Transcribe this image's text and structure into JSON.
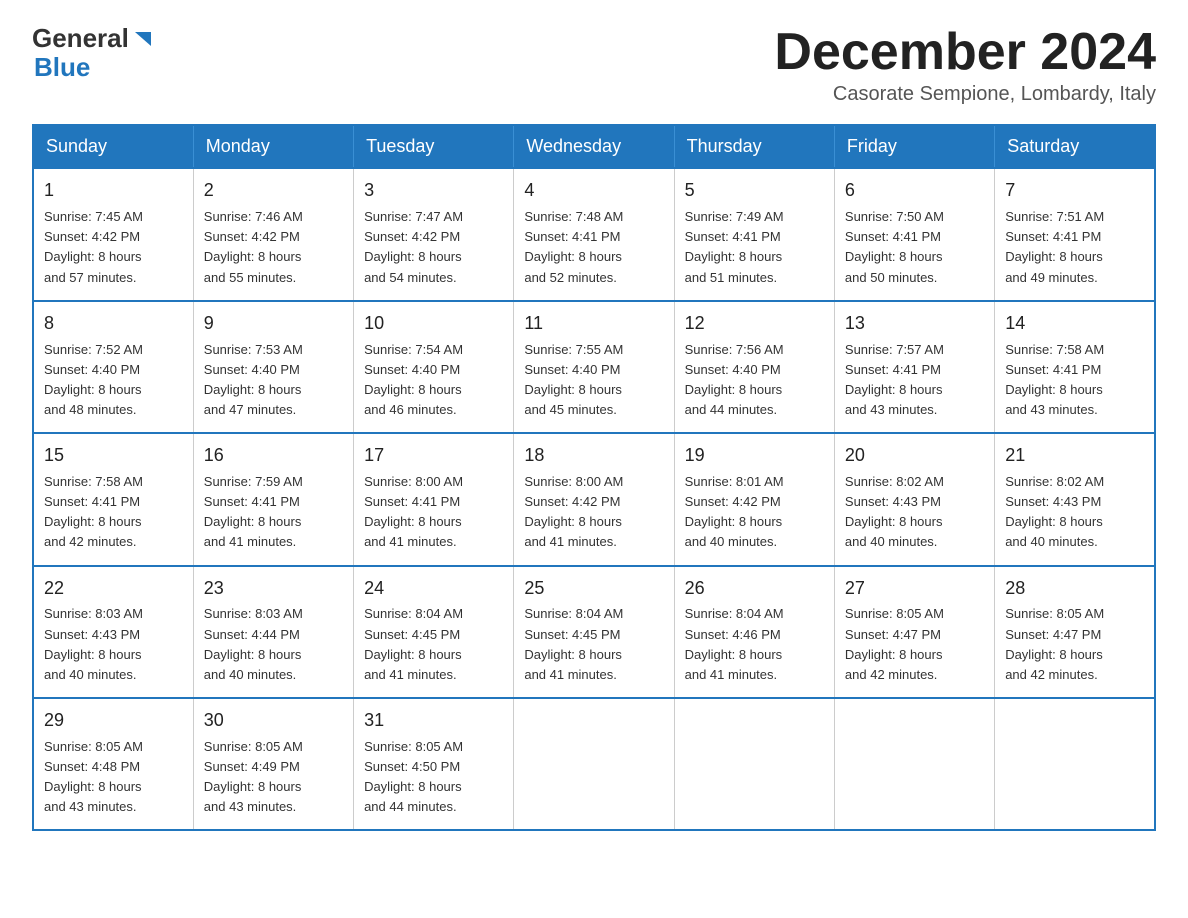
{
  "header": {
    "logo_general": "General",
    "logo_blue": "Blue",
    "month_title": "December 2024",
    "subtitle": "Casorate Sempione, Lombardy, Italy"
  },
  "weekdays": [
    "Sunday",
    "Monday",
    "Tuesday",
    "Wednesday",
    "Thursday",
    "Friday",
    "Saturday"
  ],
  "weeks": [
    [
      {
        "day": "1",
        "sunrise": "7:45 AM",
        "sunset": "4:42 PM",
        "daylight": "8 hours and 57 minutes."
      },
      {
        "day": "2",
        "sunrise": "7:46 AM",
        "sunset": "4:42 PM",
        "daylight": "8 hours and 55 minutes."
      },
      {
        "day": "3",
        "sunrise": "7:47 AM",
        "sunset": "4:42 PM",
        "daylight": "8 hours and 54 minutes."
      },
      {
        "day": "4",
        "sunrise": "7:48 AM",
        "sunset": "4:41 PM",
        "daylight": "8 hours and 52 minutes."
      },
      {
        "day": "5",
        "sunrise": "7:49 AM",
        "sunset": "4:41 PM",
        "daylight": "8 hours and 51 minutes."
      },
      {
        "day": "6",
        "sunrise": "7:50 AM",
        "sunset": "4:41 PM",
        "daylight": "8 hours and 50 minutes."
      },
      {
        "day": "7",
        "sunrise": "7:51 AM",
        "sunset": "4:41 PM",
        "daylight": "8 hours and 49 minutes."
      }
    ],
    [
      {
        "day": "8",
        "sunrise": "7:52 AM",
        "sunset": "4:40 PM",
        "daylight": "8 hours and 48 minutes."
      },
      {
        "day": "9",
        "sunrise": "7:53 AM",
        "sunset": "4:40 PM",
        "daylight": "8 hours and 47 minutes."
      },
      {
        "day": "10",
        "sunrise": "7:54 AM",
        "sunset": "4:40 PM",
        "daylight": "8 hours and 46 minutes."
      },
      {
        "day": "11",
        "sunrise": "7:55 AM",
        "sunset": "4:40 PM",
        "daylight": "8 hours and 45 minutes."
      },
      {
        "day": "12",
        "sunrise": "7:56 AM",
        "sunset": "4:40 PM",
        "daylight": "8 hours and 44 minutes."
      },
      {
        "day": "13",
        "sunrise": "7:57 AM",
        "sunset": "4:41 PM",
        "daylight": "8 hours and 43 minutes."
      },
      {
        "day": "14",
        "sunrise": "7:58 AM",
        "sunset": "4:41 PM",
        "daylight": "8 hours and 43 minutes."
      }
    ],
    [
      {
        "day": "15",
        "sunrise": "7:58 AM",
        "sunset": "4:41 PM",
        "daylight": "8 hours and 42 minutes."
      },
      {
        "day": "16",
        "sunrise": "7:59 AM",
        "sunset": "4:41 PM",
        "daylight": "8 hours and 41 minutes."
      },
      {
        "day": "17",
        "sunrise": "8:00 AM",
        "sunset": "4:41 PM",
        "daylight": "8 hours and 41 minutes."
      },
      {
        "day": "18",
        "sunrise": "8:00 AM",
        "sunset": "4:42 PM",
        "daylight": "8 hours and 41 minutes."
      },
      {
        "day": "19",
        "sunrise": "8:01 AM",
        "sunset": "4:42 PM",
        "daylight": "8 hours and 40 minutes."
      },
      {
        "day": "20",
        "sunrise": "8:02 AM",
        "sunset": "4:43 PM",
        "daylight": "8 hours and 40 minutes."
      },
      {
        "day": "21",
        "sunrise": "8:02 AM",
        "sunset": "4:43 PM",
        "daylight": "8 hours and 40 minutes."
      }
    ],
    [
      {
        "day": "22",
        "sunrise": "8:03 AM",
        "sunset": "4:43 PM",
        "daylight": "8 hours and 40 minutes."
      },
      {
        "day": "23",
        "sunrise": "8:03 AM",
        "sunset": "4:44 PM",
        "daylight": "8 hours and 40 minutes."
      },
      {
        "day": "24",
        "sunrise": "8:04 AM",
        "sunset": "4:45 PM",
        "daylight": "8 hours and 41 minutes."
      },
      {
        "day": "25",
        "sunrise": "8:04 AM",
        "sunset": "4:45 PM",
        "daylight": "8 hours and 41 minutes."
      },
      {
        "day": "26",
        "sunrise": "8:04 AM",
        "sunset": "4:46 PM",
        "daylight": "8 hours and 41 minutes."
      },
      {
        "day": "27",
        "sunrise": "8:05 AM",
        "sunset": "4:47 PM",
        "daylight": "8 hours and 42 minutes."
      },
      {
        "day": "28",
        "sunrise": "8:05 AM",
        "sunset": "4:47 PM",
        "daylight": "8 hours and 42 minutes."
      }
    ],
    [
      {
        "day": "29",
        "sunrise": "8:05 AM",
        "sunset": "4:48 PM",
        "daylight": "8 hours and 43 minutes."
      },
      {
        "day": "30",
        "sunrise": "8:05 AM",
        "sunset": "4:49 PM",
        "daylight": "8 hours and 43 minutes."
      },
      {
        "day": "31",
        "sunrise": "8:05 AM",
        "sunset": "4:50 PM",
        "daylight": "8 hours and 44 minutes."
      },
      null,
      null,
      null,
      null
    ]
  ],
  "labels": {
    "sunrise": "Sunrise:",
    "sunset": "Sunset:",
    "daylight": "Daylight:"
  }
}
